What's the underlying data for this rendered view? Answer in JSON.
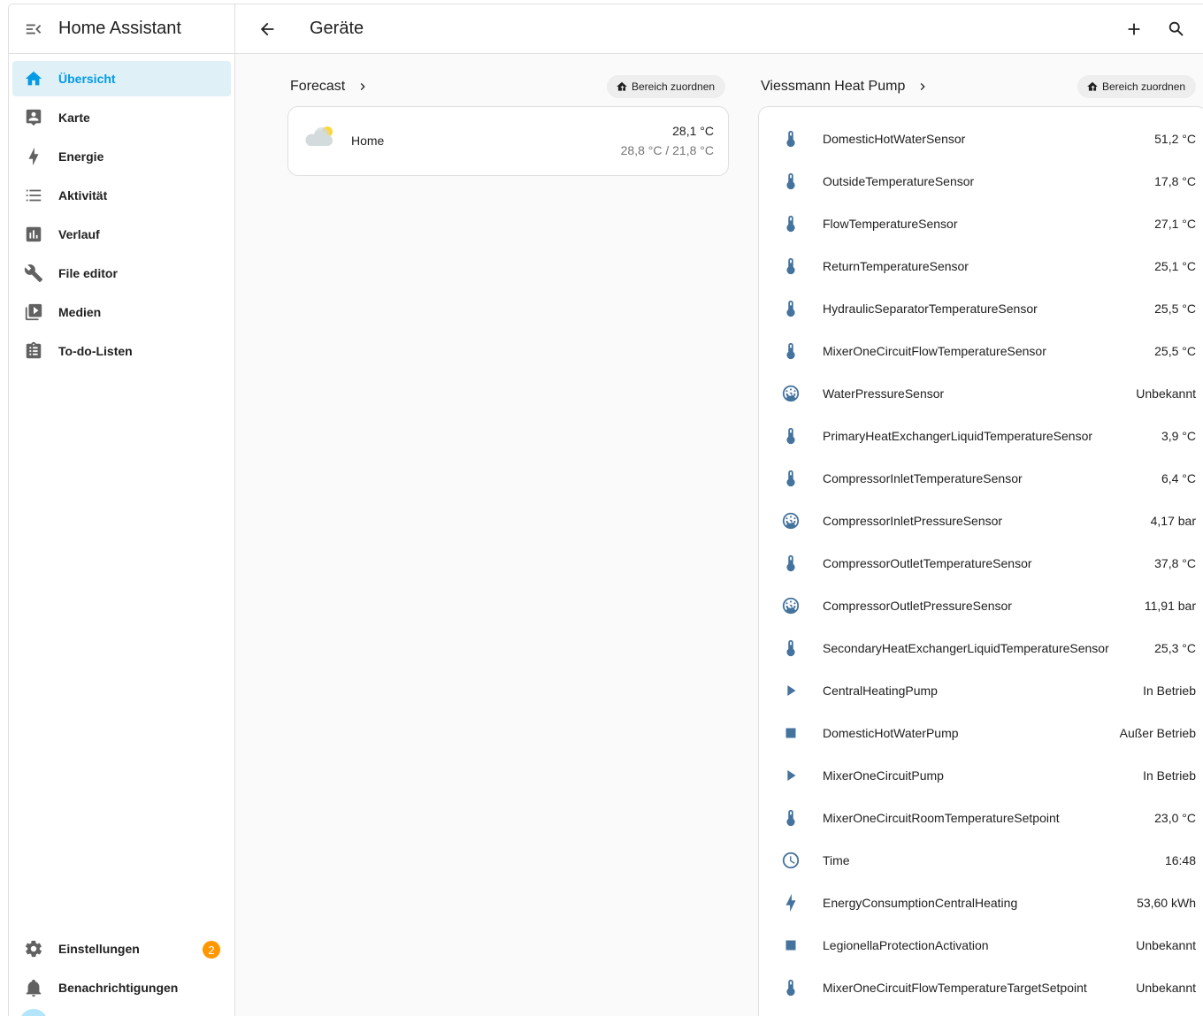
{
  "app": {
    "title": "Home Assistant"
  },
  "sidebar": {
    "items": [
      {
        "label": "Übersicht",
        "icon": "home-icon",
        "active": true
      },
      {
        "label": "Karte",
        "icon": "map-account-icon"
      },
      {
        "label": "Energie",
        "icon": "lightning-bolt-icon"
      },
      {
        "label": "Aktivität",
        "icon": "format-list-bulleted-icon"
      },
      {
        "label": "Verlauf",
        "icon": "chart-box-icon"
      },
      {
        "label": "File editor",
        "icon": "wrench-icon"
      },
      {
        "label": "Medien",
        "icon": "play-box-multiple-icon"
      },
      {
        "label": "To-do-Listen",
        "icon": "clipboard-list-icon"
      }
    ],
    "settings": {
      "label": "Einstellungen",
      "badge": "2"
    },
    "notifications": {
      "label": "Benachrichtigungen"
    }
  },
  "header": {
    "title": "Geräte"
  },
  "forecast": {
    "title": "Forecast",
    "assign_label": "Bereich zuordnen",
    "name": "Home",
    "temperature": "28,1 °C",
    "range": "28,8 °C / 21,8 °C"
  },
  "heatpump": {
    "title": "Viessmann Heat Pump",
    "assign_label": "Bereich zuordnen",
    "entities": [
      {
        "name": "DomesticHotWaterSensor",
        "value": "51,2 °C",
        "icon": "thermometer-icon"
      },
      {
        "name": "OutsideTemperatureSensor",
        "value": "17,8 °C",
        "icon": "thermometer-icon"
      },
      {
        "name": "FlowTemperatureSensor",
        "value": "27,1 °C",
        "icon": "thermometer-icon"
      },
      {
        "name": "ReturnTemperatureSensor",
        "value": "25,1 °C",
        "icon": "thermometer-icon"
      },
      {
        "name": "HydraulicSeparatorTemperatureSensor",
        "value": "25,5 °C",
        "icon": "thermometer-icon"
      },
      {
        "name": "MixerOneCircuitFlowTemperatureSensor",
        "value": "25,5 °C",
        "icon": "thermometer-icon"
      },
      {
        "name": "WaterPressureSensor",
        "value": "Unbekannt",
        "icon": "gauge-icon"
      },
      {
        "name": "PrimaryHeatExchangerLiquidTemperatureSensor",
        "value": "3,9 °C",
        "icon": "thermometer-icon"
      },
      {
        "name": "CompressorInletTemperatureSensor",
        "value": "6,4 °C",
        "icon": "thermometer-icon"
      },
      {
        "name": "CompressorInletPressureSensor",
        "value": "4,17 bar",
        "icon": "gauge-icon"
      },
      {
        "name": "CompressorOutletTemperatureSensor",
        "value": "37,8 °C",
        "icon": "thermometer-icon"
      },
      {
        "name": "CompressorOutletPressureSensor",
        "value": "11,91 bar",
        "icon": "gauge-icon"
      },
      {
        "name": "SecondaryHeatExchangerLiquidTemperatureSensor",
        "value": "25,3 °C",
        "icon": "thermometer-icon"
      },
      {
        "name": "CentralHeatingPump",
        "value": "In Betrieb",
        "icon": "play-icon"
      },
      {
        "name": "DomesticHotWaterPump",
        "value": "Außer Betrieb",
        "icon": "stop-icon"
      },
      {
        "name": "MixerOneCircuitPump",
        "value": "In Betrieb",
        "icon": "play-icon"
      },
      {
        "name": "MixerOneCircuitRoomTemperatureSetpoint",
        "value": "23,0 °C",
        "icon": "thermometer-icon"
      },
      {
        "name": "Time",
        "value": "16:48",
        "icon": "clock-icon"
      },
      {
        "name": "EnergyConsumptionCentralHeating",
        "value": "53,60 kWh",
        "icon": "lightning-bolt-icon"
      },
      {
        "name": "LegionellaProtectionActivation",
        "value": "Unbekannt",
        "icon": "stop-icon"
      },
      {
        "name": "MixerOneCircuitFlowTemperatureTargetSetpoint",
        "value": "Unbekannt",
        "icon": "thermometer-icon"
      }
    ]
  },
  "colors": {
    "accent": "#03a9f4",
    "active_bg": "#dff0f7",
    "entity_icon": "#44739e",
    "badge": "#ff9800"
  }
}
